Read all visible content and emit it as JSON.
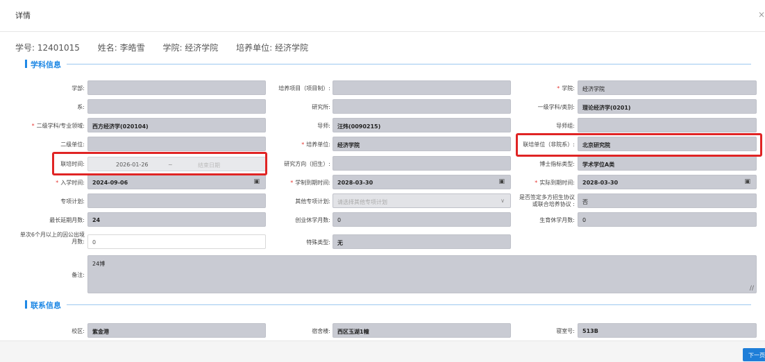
{
  "dialog": {
    "title": "详情",
    "close_glyph": "×"
  },
  "summary": {
    "student_id": "学号: 12401015",
    "name": "姓名: 李皓雪",
    "college": "学院: 经济学院",
    "unit": "培养单位: 经济学院"
  },
  "sections": {
    "subject": "学科信息",
    "contact": "联系信息"
  },
  "fields": {
    "dept": {
      "label": "学部:",
      "value": ""
    },
    "project": {
      "label": "培养项目（项目制）:",
      "value": ""
    },
    "college": {
      "label": "学院:",
      "value": "经济学院",
      "required": true
    },
    "xi": {
      "label": "系:",
      "value": ""
    },
    "institute": {
      "label": "研究所:",
      "value": ""
    },
    "first_discipline": {
      "label": "一级学科/类别:",
      "value": "理论经济学(0201)"
    },
    "second_discipline": {
      "label": "二级学科/专业领域:",
      "value": "西方经济学(020104)",
      "required": true
    },
    "advisor": {
      "label": "导师:",
      "value": "汪炜(0090215)"
    },
    "advisor_group": {
      "label": "导师组:",
      "value": ""
    },
    "second_unit": {
      "label": "二级单位:",
      "value": ""
    },
    "training_unit": {
      "label": "培养单位:",
      "value": "经济学院",
      "required": true
    },
    "joint_unit": {
      "label": "联培单位（非院系）:",
      "value": "北京研究院"
    },
    "joint_time": {
      "label": "联培时间:",
      "start": "2026-01-26",
      "sep": "~",
      "end_placeholder": "结束日期"
    },
    "research_direction": {
      "label": "研究方向（招生）:",
      "value": ""
    },
    "phd_type": {
      "label": "博士指标类型:",
      "value": "学术学位A类"
    },
    "enroll_date": {
      "label": "入学时间:",
      "value": "2024-09-06",
      "required": true
    },
    "due_date": {
      "label": "学制到期时间:",
      "value": "2028-03-30",
      "required": true
    },
    "actual_due_date": {
      "label": "实际到期时间:",
      "value": "2028-03-30",
      "required": true
    },
    "special_plan": {
      "label": "专项计划:",
      "value": ""
    },
    "other_plan": {
      "label": "其他专项计划:",
      "placeholder": "请选择其他专项计划"
    },
    "multi_agreement": {
      "label_line1": "是否签定多方招生协议",
      "label_line2": "或联合培养协议",
      "colon": ":",
      "value": "否"
    },
    "max_extend": {
      "label": "最长延期月数:",
      "value": "24"
    },
    "business_leave": {
      "label": "创业休学月数:",
      "value": "0"
    },
    "maternity_leave": {
      "label": "生育休学月数:",
      "value": "0"
    },
    "abroad_months": {
      "label_line1": "单次6个月以上的因公出境",
      "label_line2": "月数:",
      "value": "0"
    },
    "special_type": {
      "label": "特殊类型:",
      "value": "无"
    },
    "remarks": {
      "label": "备注:",
      "value": "24博"
    },
    "campus": {
      "label": "校区:",
      "value": "紫金港"
    },
    "dorm": {
      "label": "宿舍楼:",
      "value": "西区玉湖1幢"
    },
    "room": {
      "label": "寝室号:",
      "value": "513B"
    }
  },
  "footer": {
    "next_label": "下一页"
  },
  "icons": {
    "calendar": "calendar-icon",
    "chevron": "chevron-down-icon",
    "resize": "resize-grip-icon"
  },
  "colors": {
    "accent": "#1e88e5",
    "highlight": "#e02424",
    "field_bg": "#c9cbd3"
  }
}
